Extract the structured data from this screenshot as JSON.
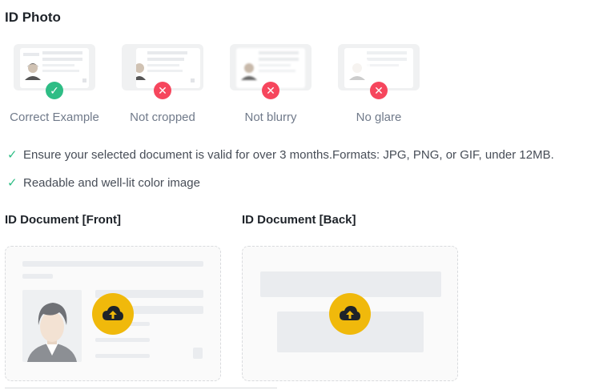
{
  "id_photo": {
    "title": "ID Photo",
    "examples": [
      {
        "label": "Correct Example",
        "status": "correct",
        "icon": "check-circle-icon"
      },
      {
        "label": "Not cropped",
        "status": "incorrect",
        "icon": "x-circle-icon"
      },
      {
        "label": "Not blurry",
        "status": "incorrect",
        "icon": "x-circle-icon"
      },
      {
        "label": "No glare",
        "status": "incorrect",
        "icon": "x-circle-icon"
      }
    ],
    "requirements": [
      "Ensure your selected document is valid for over 3 months.Formats: JPG, PNG, or GIF, under 12MB.",
      "Readable and well-lit color image"
    ]
  },
  "documents": {
    "front": {
      "title": "ID Document [Front]",
      "icon": "upload-cloud-icon"
    },
    "back": {
      "title": "ID Document [Back]",
      "icon": "upload-cloud-icon"
    }
  },
  "colors": {
    "success": "#2ebd85",
    "error": "#f6465d",
    "accent": "#f0b90b"
  }
}
